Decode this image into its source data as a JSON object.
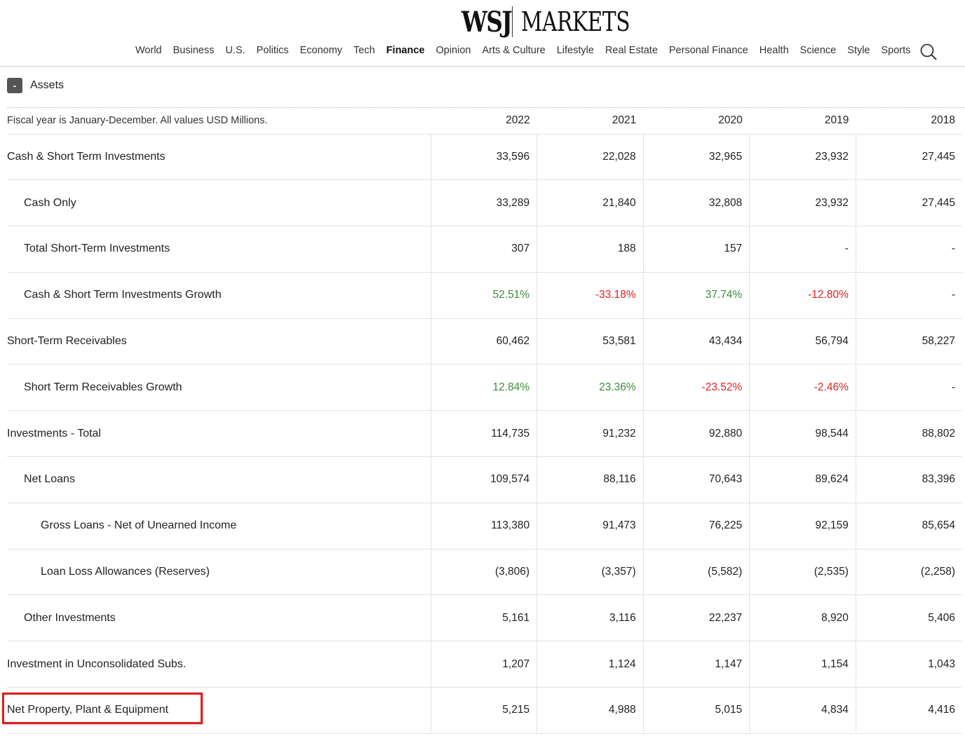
{
  "header": {
    "logo_left": "WSJ",
    "logo_right": "MARKETS",
    "nav": [
      "World",
      "Business",
      "U.S.",
      "Politics",
      "Economy",
      "Tech",
      "Finance",
      "Opinion",
      "Arts & Culture",
      "Lifestyle",
      "Real Estate",
      "Personal Finance",
      "Health",
      "Science",
      "Style",
      "Sports"
    ],
    "active_nav": "Finance"
  },
  "section": {
    "toggle_label": "-",
    "title": "Assets",
    "note": "Fiscal year is January-December. All values USD Millions.",
    "years": [
      "2022",
      "2021",
      "2020",
      "2019",
      "2018"
    ]
  },
  "rows": [
    {
      "label": "Cash & Short Term Investments",
      "level": 0,
      "values": [
        "33,596",
        "22,028",
        "32,965",
        "23,932",
        "27,445"
      ],
      "tones": [
        "",
        "",
        "",
        "",
        ""
      ]
    },
    {
      "label": "Cash Only",
      "level": 1,
      "values": [
        "33,289",
        "21,840",
        "32,808",
        "23,932",
        "27,445"
      ],
      "tones": [
        "",
        "",
        "",
        "",
        ""
      ]
    },
    {
      "label": "Total Short-Term Investments",
      "level": 1,
      "values": [
        "307",
        "188",
        "157",
        "-",
        "-"
      ],
      "tones": [
        "",
        "",
        "",
        "",
        ""
      ]
    },
    {
      "label": "Cash & Short Term Investments Growth",
      "level": 1,
      "values": [
        "52.51%",
        "-33.18%",
        "37.74%",
        "-12.80%",
        "-"
      ],
      "tones": [
        "pos",
        "neg",
        "pos",
        "neg",
        ""
      ]
    },
    {
      "label": "Short-Term Receivables",
      "level": 0,
      "values": [
        "60,462",
        "53,581",
        "43,434",
        "56,794",
        "58,227"
      ],
      "tones": [
        "",
        "",
        "",
        "",
        ""
      ]
    },
    {
      "label": "Short Term Receivables Growth",
      "level": 1,
      "values": [
        "12.84%",
        "23.36%",
        "-23.52%",
        "-2.46%",
        "-"
      ],
      "tones": [
        "pos",
        "pos",
        "neg",
        "neg",
        ""
      ]
    },
    {
      "label": "Investments - Total",
      "level": 0,
      "values": [
        "114,735",
        "91,232",
        "92,880",
        "98,544",
        "88,802"
      ],
      "tones": [
        "",
        "",
        "",
        "",
        ""
      ]
    },
    {
      "label": "Net Loans",
      "level": 1,
      "values": [
        "109,574",
        "88,116",
        "70,643",
        "89,624",
        "83,396"
      ],
      "tones": [
        "",
        "",
        "",
        "",
        ""
      ]
    },
    {
      "label": "Gross Loans - Net of Unearned Income",
      "level": 2,
      "values": [
        "113,380",
        "91,473",
        "76,225",
        "92,159",
        "85,654"
      ],
      "tones": [
        "",
        "",
        "",
        "",
        ""
      ]
    },
    {
      "label": "Loan Loss Allowances (Reserves)",
      "level": 2,
      "values": [
        "(3,806)",
        "(3,357)",
        "(5,582)",
        "(2,535)",
        "(2,258)"
      ],
      "tones": [
        "",
        "",
        "",
        "",
        ""
      ]
    },
    {
      "label": "Other Investments",
      "level": 1,
      "values": [
        "5,161",
        "3,116",
        "22,237",
        "8,920",
        "5,406"
      ],
      "tones": [
        "",
        "",
        "",
        "",
        ""
      ]
    },
    {
      "label": "Investment in Unconsolidated Subs.",
      "level": 0,
      "values": [
        "1,207",
        "1,124",
        "1,147",
        "1,154",
        "1,043"
      ],
      "tones": [
        "",
        "",
        "",
        "",
        ""
      ]
    },
    {
      "label": "Net Property, Plant & Equipment",
      "level": 0,
      "values": [
        "5,215",
        "4,988",
        "5,015",
        "4,834",
        "4,416"
      ],
      "tones": [
        "",
        "",
        "",
        "",
        ""
      ],
      "highlighted": true
    }
  ],
  "colors": {
    "positive": "#3d8b3d",
    "negative": "#e02020",
    "highlight": "#e01c1c"
  }
}
